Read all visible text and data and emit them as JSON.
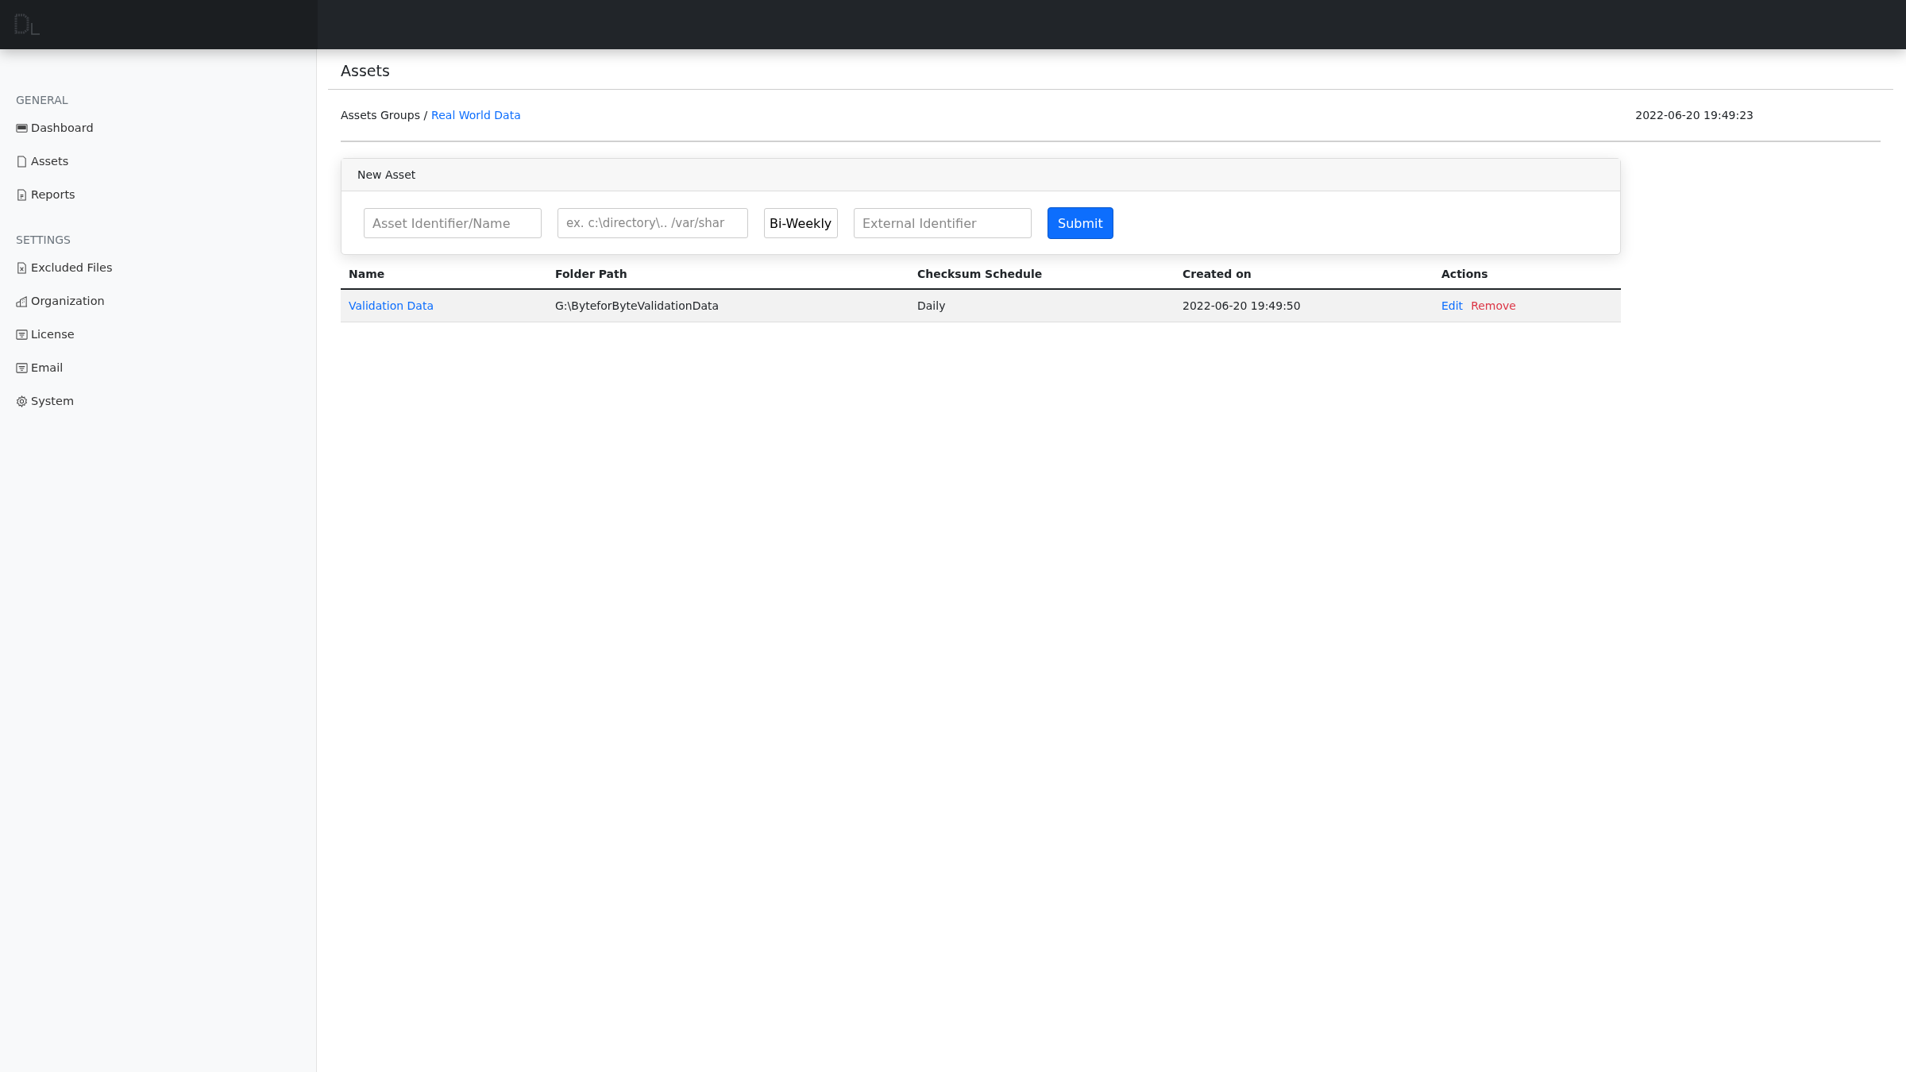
{
  "sidebar": {
    "sections": [
      {
        "heading": "GENERAL",
        "items": [
          {
            "label": "Dashboard",
            "kind": "monitor"
          },
          {
            "label": "Assets",
            "kind": "file"
          },
          {
            "label": "Reports",
            "kind": "report"
          }
        ]
      },
      {
        "heading": "SETTINGS",
        "items": [
          {
            "label": "Excluded Files",
            "kind": "filex"
          },
          {
            "label": "Organization",
            "kind": "building"
          },
          {
            "label": "License",
            "kind": "list"
          },
          {
            "label": "Email",
            "kind": "list"
          },
          {
            "label": "System",
            "kind": "gear"
          }
        ]
      }
    ]
  },
  "page": {
    "title": "Assets",
    "breadcrumb": {
      "parent": "Assets Groups /",
      "current": "Real World Data"
    },
    "timestamp": "2022-06-20 19:49:23"
  },
  "form": {
    "title": "New Asset",
    "name_placeholder": "Asset Identifier/Name",
    "path_placeholder": "ex. c:\\directory\\.. /var/shar",
    "schedule": "Bi-Weekly",
    "external_placeholder": "External Identifier",
    "submit": "Submit"
  },
  "table": {
    "columns": [
      "Name",
      "Folder Path",
      "Checksum Schedule",
      "Created on",
      "Actions"
    ],
    "rows": [
      {
        "name": "Validation Data",
        "path": "G:\\ByteforByteValidationData",
        "schedule": "Daily",
        "created": "2022-06-20 19:49:50",
        "edit": "Edit",
        "remove": "Remove"
      }
    ]
  }
}
